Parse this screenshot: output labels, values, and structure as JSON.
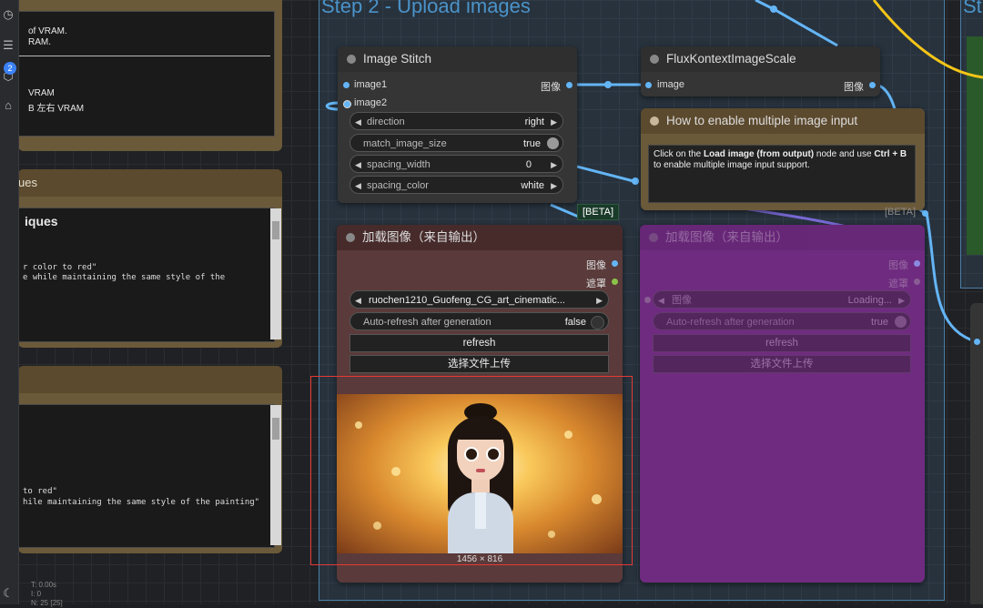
{
  "group": {
    "title": "Step 2 - Upload images",
    "title2": "St"
  },
  "stats": {
    "line1": "T: 0.00s",
    "line2": "I: 0",
    "line3": "N: 25 [25]"
  },
  "sidebar": {
    "badge": "2"
  },
  "left_panels": {
    "panel1": {
      "lines": [
        "of VRAM.",
        "RAM.",
        "VRAM",
        "B 左右 VRAM"
      ]
    },
    "panel2": {
      "header": "ues",
      "heading": "iques",
      "lines": [
        "r color to red\"",
        "e while maintaining the same style of the"
      ]
    },
    "panel3": {
      "lines": [
        "to red\"",
        "hile maintaining the same style of the painting\""
      ]
    }
  },
  "image_stitch": {
    "title": "Image Stitch",
    "inputs": [
      "image1",
      "image2"
    ],
    "output": "图像",
    "widgets": [
      {
        "label": "direction",
        "value": "right"
      },
      {
        "label": "match_image_size",
        "value": "true"
      },
      {
        "label": "spacing_width",
        "value": "0"
      },
      {
        "label": "spacing_color",
        "value": "white"
      }
    ]
  },
  "flux_scale": {
    "title": "FluxKontextImageScale",
    "input": "image",
    "output": "图像"
  },
  "note_node": {
    "title": "How to enable multiple image input",
    "text_pre": "Click on the ",
    "text_bold1": "Load image (from output)",
    "text_mid": " node and use ",
    "text_bold2": "Ctrl + B",
    "text_line2": "to enable multiple image input support.",
    "beta": "[BETA]"
  },
  "load_image": {
    "title": "加载图像（来自输出）",
    "beta": "[BETA]",
    "outputs": [
      "图像",
      "遮罩"
    ],
    "file": "ruochen1210_Guofeng_CG_art_cinematic...",
    "auto_refresh_label": "Auto-refresh after generation",
    "auto_refresh_value": "false",
    "refresh": "refresh",
    "upload": "选择文件上传",
    "size": "1456 × 816"
  },
  "load_image_2": {
    "title": "加载图像（来自输出）",
    "beta": "[BETA]",
    "outputs": [
      "图像",
      "遮罩"
    ],
    "input": "图像",
    "file": "Loading...",
    "auto_refresh_label": "Auto-refresh after generation",
    "auto_refresh_value": "true",
    "refresh": "refresh",
    "upload": "选择文件上传"
  },
  "colors": {
    "wire_image": "#64b5f6",
    "wire_yellow": "#f5c518",
    "highlight": "#e53935",
    "load_node_bg": "#5a3a3a",
    "purple_node": "#7a2a8a"
  }
}
